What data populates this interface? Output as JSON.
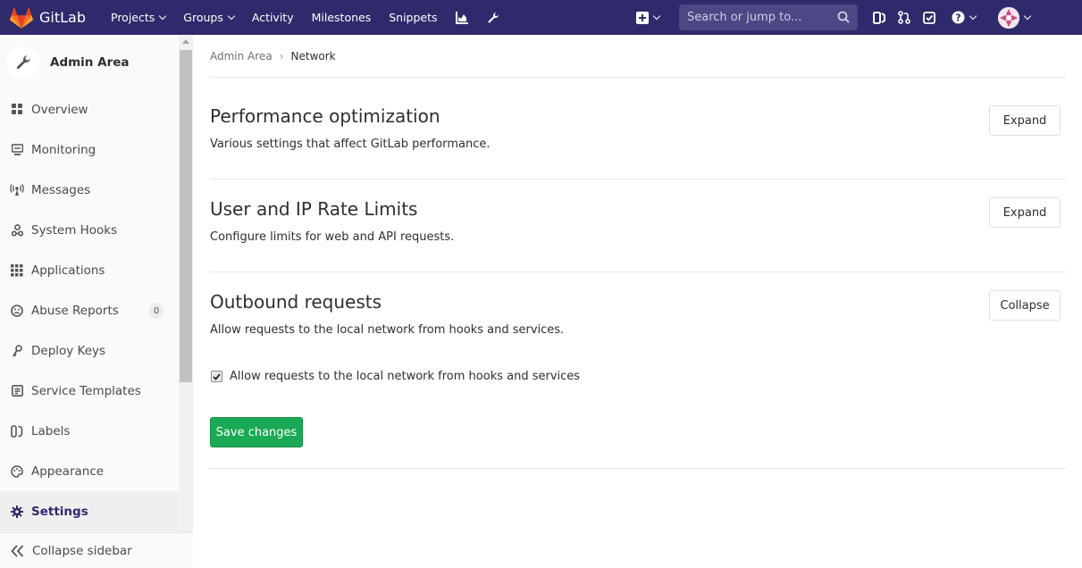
{
  "navbar": {
    "brand": "GitLab",
    "links": [
      {
        "label": "Projects",
        "dropdown": true
      },
      {
        "label": "Groups",
        "dropdown": true
      },
      {
        "label": "Activity",
        "dropdown": false
      },
      {
        "label": "Milestones",
        "dropdown": false
      },
      {
        "label": "Snippets",
        "dropdown": false
      }
    ],
    "search_placeholder": "Search or jump to...",
    "bg_color": "#2f2a6b"
  },
  "sidebar": {
    "title": "Admin Area",
    "items": [
      {
        "label": "Overview",
        "icon": "overview-icon"
      },
      {
        "label": "Monitoring",
        "icon": "monitoring-icon"
      },
      {
        "label": "Messages",
        "icon": "messages-icon"
      },
      {
        "label": "System Hooks",
        "icon": "hooks-icon"
      },
      {
        "label": "Applications",
        "icon": "applications-icon"
      },
      {
        "label": "Abuse Reports",
        "icon": "abuse-icon",
        "badge": "0"
      },
      {
        "label": "Deploy Keys",
        "icon": "key-icon"
      },
      {
        "label": "Service Templates",
        "icon": "templates-icon"
      },
      {
        "label": "Labels",
        "icon": "labels-icon"
      },
      {
        "label": "Appearance",
        "icon": "appearance-icon"
      },
      {
        "label": "Settings",
        "icon": "settings-icon",
        "active": true
      }
    ],
    "collapse_label": "Collapse sidebar"
  },
  "breadcrumb": {
    "parent": "Admin Area",
    "current": "Network"
  },
  "sections": [
    {
      "title": "Performance optimization",
      "description": "Various settings that affect GitLab performance.",
      "button": "Expand"
    },
    {
      "title": "User and IP Rate Limits",
      "description": "Configure limits for web and API requests.",
      "button": "Expand"
    },
    {
      "title": "Outbound requests",
      "description": "Allow requests to the local network from hooks and services.",
      "button": "Collapse",
      "checkbox_label": "Allow requests to the local network from hooks and services",
      "checkbox_checked": true,
      "save_label": "Save changes"
    }
  ],
  "colors": {
    "accent": "#2f2a6b",
    "save": "#1aaa55"
  }
}
